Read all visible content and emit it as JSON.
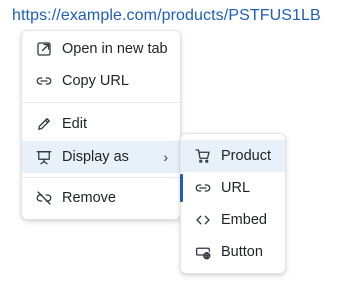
{
  "link": {
    "text": "https://example.com/products/PSTFUS1LB"
  },
  "context_menu": {
    "items": [
      {
        "label": "Open in new tab",
        "icon": "external-link-icon"
      },
      {
        "label": "Copy URL",
        "icon": "link-icon"
      },
      {
        "label": "Edit",
        "icon": "pencil-icon"
      },
      {
        "label": "Display as",
        "icon": "presentation-icon",
        "has_submenu": true,
        "chevron": "›"
      },
      {
        "label": "Remove",
        "icon": "link-off-icon"
      }
    ]
  },
  "display_as_submenu": {
    "items": [
      {
        "label": "Product",
        "icon": "cart-icon",
        "state": "hovered"
      },
      {
        "label": "URL",
        "icon": "link-icon",
        "state": "selected"
      },
      {
        "label": "Embed",
        "icon": "code-icon"
      },
      {
        "label": "Button",
        "icon": "button-link-icon"
      }
    ]
  },
  "colors": {
    "link": "#1d5fb8",
    "hover_background": "#e8f0f9",
    "selected_indicator": "#1d5fb8"
  }
}
